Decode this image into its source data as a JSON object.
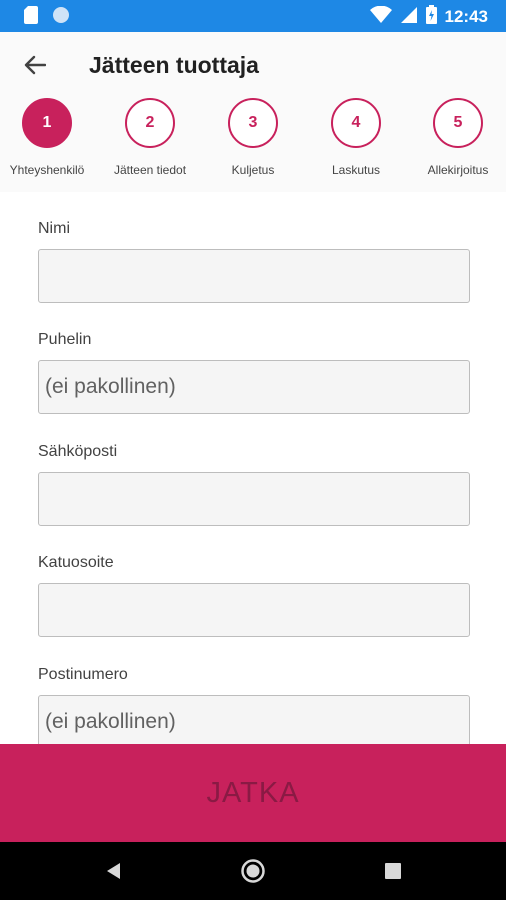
{
  "status_bar": {
    "time": "12:43",
    "icons": [
      "sd-card-icon",
      "circle-notification-icon",
      "wifi-icon",
      "signal-icon",
      "battery-icon"
    ],
    "background": "#1e88e5"
  },
  "header": {
    "title": "Jätteen tuottaja",
    "back_icon": "arrow-left-icon"
  },
  "steps": [
    {
      "number": "1",
      "label": "Yhteyshenkilö",
      "active": true
    },
    {
      "number": "2",
      "label": "Jätteen tiedot",
      "active": false
    },
    {
      "number": "3",
      "label": "Kuljetus",
      "active": false
    },
    {
      "number": "4",
      "label": "Laskutus",
      "active": false
    },
    {
      "number": "5",
      "label": "Allekirjoitus",
      "active": false
    }
  ],
  "form": {
    "fields": [
      {
        "label": "Nimi",
        "value": "",
        "placeholder": ""
      },
      {
        "label": "Puhelin",
        "value": "",
        "placeholder": "(ei pakollinen)"
      },
      {
        "label": "Sähköposti",
        "value": "",
        "placeholder": ""
      },
      {
        "label": "Katuosoite",
        "value": "",
        "placeholder": ""
      },
      {
        "label": "Postinumero",
        "value": "",
        "placeholder": "(ei pakollinen)"
      }
    ]
  },
  "continue_button": {
    "label": "JATKA"
  },
  "nav_bar": {
    "icons": [
      "back-triangle-icon",
      "home-circle-icon",
      "recents-square-icon"
    ]
  },
  "colors": {
    "accent": "#c8215c",
    "status_bar": "#1e88e5",
    "nav_bar": "#000000"
  }
}
